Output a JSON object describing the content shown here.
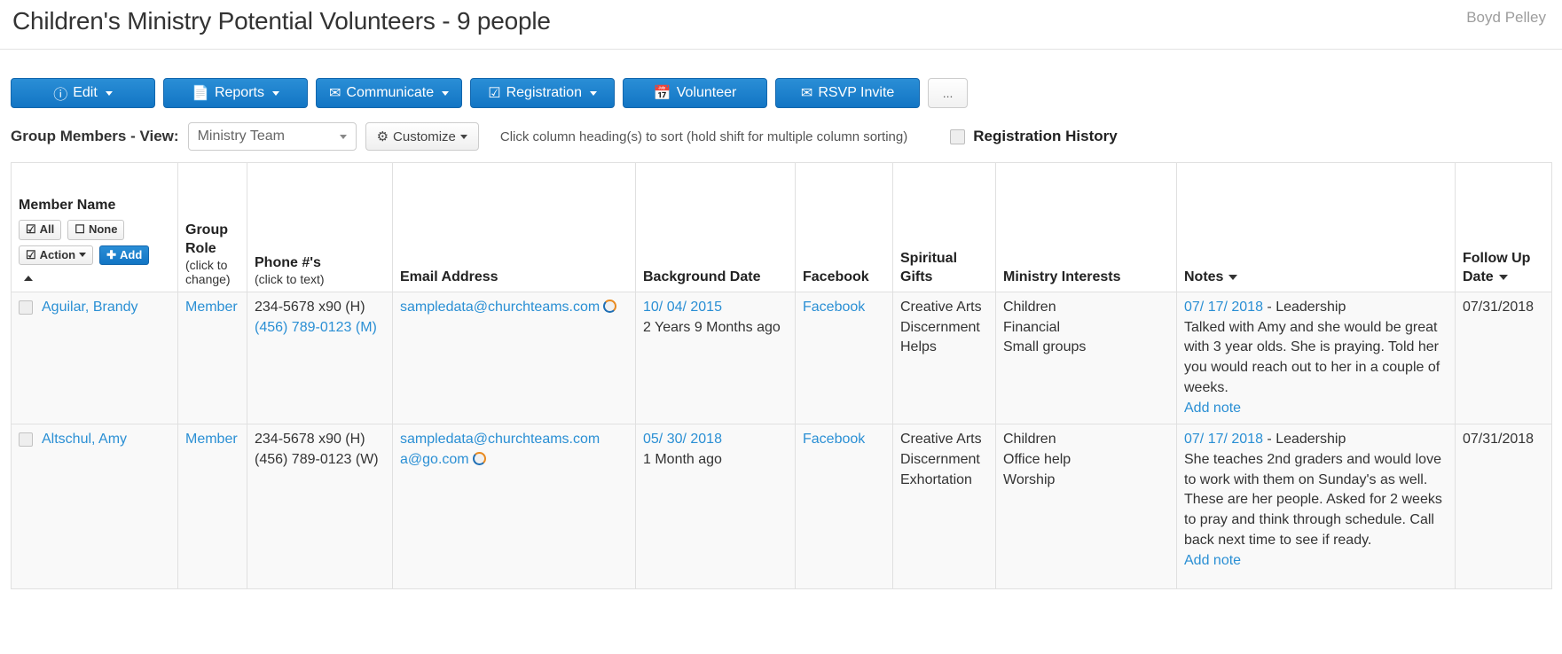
{
  "header": {
    "title": "Children's Ministry Potential Volunteers - 9 people",
    "user": "Boyd Pelley"
  },
  "toolbar": {
    "buttons": [
      {
        "label": "Edit",
        "icon": "info-icon",
        "caret": true
      },
      {
        "label": "Reports",
        "icon": "file-icon",
        "caret": true
      },
      {
        "label": "Communicate",
        "icon": "envelope-icon",
        "caret": true
      },
      {
        "label": "Registration",
        "icon": "check-square-icon",
        "caret": true
      },
      {
        "label": "Volunteer",
        "icon": "calendar-icon",
        "caret": false
      },
      {
        "label": "RSVP Invite",
        "icon": "envelope-open-icon",
        "caret": false
      }
    ],
    "more_label": "..."
  },
  "viewbar": {
    "label": "Group Members - View:",
    "select_value": "Ministry Team",
    "customize_label": "Customize",
    "sort_hint": "Click column heading(s) to sort (hold shift for multiple column sorting)",
    "registration_history_label": "Registration History"
  },
  "table": {
    "columns": [
      {
        "title": "Member Name",
        "sub": "",
        "shaded": false,
        "sort": "up"
      },
      {
        "title": "Group Role",
        "sub": "(click to change)",
        "shaded": false,
        "sort": ""
      },
      {
        "title": "Phone #'s",
        "sub": "(click to text)",
        "shaded": false,
        "sort": ""
      },
      {
        "title": "Email Address",
        "sub": "",
        "shaded": false,
        "sort": ""
      },
      {
        "title": "Background Date",
        "sub": "",
        "shaded": false,
        "sort": ""
      },
      {
        "title": "Facebook",
        "sub": "",
        "shaded": false,
        "sort": ""
      },
      {
        "title": "Spiritual Gifts",
        "sub": "",
        "shaded": false,
        "sort": ""
      },
      {
        "title": "Ministry Interests",
        "sub": "",
        "shaded": false,
        "sort": ""
      },
      {
        "title": "Notes",
        "sub": "",
        "shaded": true,
        "sort": "down"
      },
      {
        "title": "Follow Up Date",
        "sub": "",
        "shaded": false,
        "sort": "down"
      }
    ],
    "select_all_label": "All",
    "select_none_label": "None",
    "action_label": "Action",
    "add_label": "Add",
    "rows": [
      {
        "name": "Aguilar, Brandy",
        "role": "Member",
        "phone1": "234-5678 x90 (H)",
        "phone2": "(456) 789-0123 (M)",
        "phone2_link": true,
        "email1": "sampledata@churchteams.com",
        "email1_icon": true,
        "email2": "",
        "email2_icon": false,
        "background_date": "10/ 04/ 2015",
        "background_ago": "2 Years 9 Months ago",
        "facebook": "Facebook",
        "gifts": [
          "Creative Arts",
          "Discernment",
          "Helps"
        ],
        "interests": [
          "Children",
          "Financial",
          "Small groups"
        ],
        "note_date": "07/ 17/ 2018",
        "note_author": " - Leadership",
        "note_body": "Talked with Amy and she would be great with 3 year olds. She is praying. Told her you would reach out to her in a couple of weeks.",
        "add_note": "Add note",
        "follow_up": "07/31/2018"
      },
      {
        "name": "Altschul, Amy",
        "role": "Member",
        "phone1": "234-5678 x90 (H)",
        "phone2": "(456) 789-0123 (W)",
        "phone2_link": false,
        "email1": "sampledata@churchteams.com",
        "email1_icon": false,
        "email2": "a@go.com",
        "email2_icon": true,
        "background_date": "05/ 30/ 2018",
        "background_ago": "1 Month ago",
        "facebook": "Facebook",
        "gifts": [
          "Creative Arts",
          "Discernment",
          "Exhortation"
        ],
        "interests": [
          "Children",
          "Office help",
          "Worship"
        ],
        "note_date": "07/ 17/ 2018",
        "note_author": " - Leadership",
        "note_body": "She teaches 2nd graders and would love to work with them on Sunday's as well. These are her people. Asked for 2 weeks to pray and think through schedule. Call back next time to see if ready.",
        "add_note": "Add note",
        "follow_up": "07/31/2018"
      }
    ]
  }
}
